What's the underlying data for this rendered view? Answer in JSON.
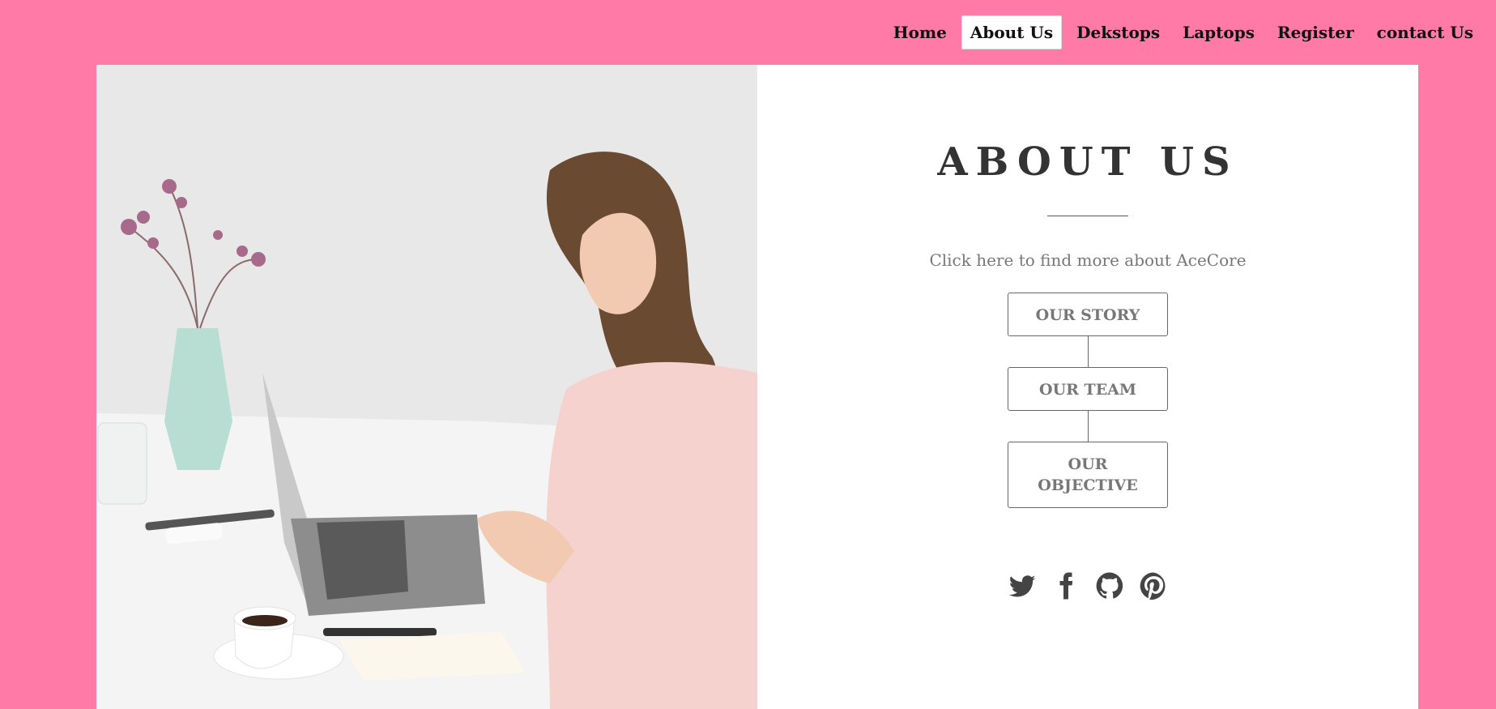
{
  "nav": {
    "items": [
      {
        "label": "Home",
        "active": false
      },
      {
        "label": "About Us",
        "active": true
      },
      {
        "label": "Dekstops",
        "active": false
      },
      {
        "label": "Laptops",
        "active": false
      },
      {
        "label": "Register",
        "active": false
      },
      {
        "label": "contact Us",
        "active": false
      }
    ]
  },
  "about": {
    "title": "ABOUT US",
    "subtitle": "Click here to find more about AceCore",
    "buttons": [
      "OUR STORY",
      "OUR TEAM",
      "OUR OBJECTIVE"
    ]
  },
  "social": [
    "twitter-icon",
    "facebook-icon",
    "github-icon",
    "pinterest-icon"
  ],
  "colors": {
    "background": "#ff7aa6",
    "card": "#ffffff",
    "title": "#333333",
    "button_border": "#666666"
  }
}
